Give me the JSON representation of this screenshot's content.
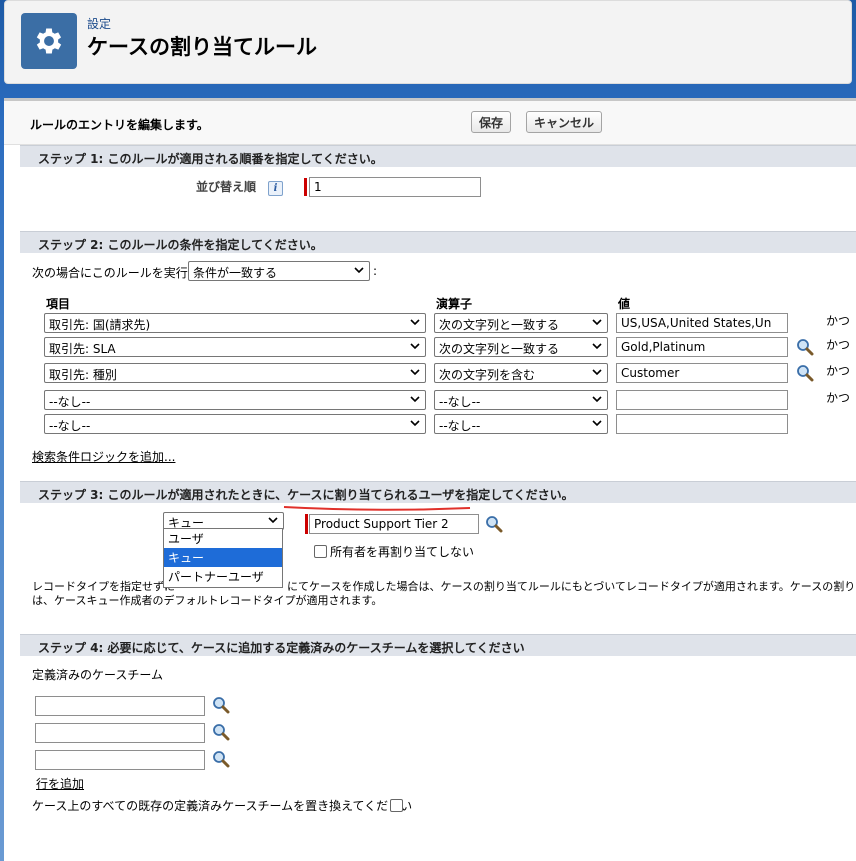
{
  "header": {
    "breadcrumb": "設定",
    "title": "ケースの割り当てルール",
    "icon": "gear-icon"
  },
  "topbar": {
    "title": "ルールのエントリを編集します。",
    "save_label": "保存",
    "cancel_label": "キャンセル"
  },
  "step1": {
    "title": "ステップ 1: このルールが適用される順番を指定してください。",
    "sort_label": "並び替え順",
    "sort_value": "1"
  },
  "step2": {
    "title": "ステップ 2: このルールの条件を指定してください。",
    "run_label": "次の場合にこのルールを実行:",
    "run_value": "条件が一致する",
    "run_suffix": ":",
    "col_field": "項目",
    "col_operator": "演算子",
    "col_value": "値",
    "rows": [
      {
        "field": "取引先: 国(請求先)",
        "operator": "次の文字列と一致する",
        "value": "US,USA,United States,Un",
        "and": "かつ"
      },
      {
        "field": "取引先: SLA",
        "operator": "次の文字列と一致する",
        "value": "Gold,Platinum",
        "and": "かつ"
      },
      {
        "field": "取引先: 種別",
        "operator": "次の文字列を含む",
        "value": "Customer",
        "and": "かつ"
      },
      {
        "field": "--なし--",
        "operator": "--なし--",
        "value": "",
        "and": "かつ"
      },
      {
        "field": "--なし--",
        "operator": "--なし--",
        "value": "",
        "and": ""
      }
    ],
    "add_logic_link": "検索条件ロジックを追加..."
  },
  "step3": {
    "title": "ステップ 3: このルールが適用されたときに、ケースに割り当てられるユーザを指定してください。",
    "assignee_type": "キュー",
    "assignee_options": [
      "ユーザ",
      "キュー",
      "パートナーユーザ"
    ],
    "assignee_selected_index": 1,
    "assignee_value": "Product Support Tier 2",
    "no_reassign_label": "所有者を再割り当てしない",
    "note_line1_left": "レコードタイプを指定せずに",
    "note_line1_right": "にてケースを作成した場合は、ケースの割り当てルールにもとづいてレコードタイプが適用されます。ケースの割り当て",
    "note_line2": "は、ケースキュー作成者のデフォルトレコードタイプが適用されます。"
  },
  "step4": {
    "title": "ステップ 4: 必要に応じて、ケースに追加する定義済みのケースチームを選択してください",
    "team_label": "定義済みのケースチーム",
    "team_values": [
      "",
      "",
      ""
    ],
    "add_row_link": "行を追加",
    "replace_label": "ケース上のすべての既存の定義済みケースチームを置き換えてください"
  },
  "colors": {
    "step_bar": "#dfe3ea",
    "required": "#cc0000",
    "selected_option": "#1e6cd8",
    "annotation_red": "#e0312b"
  }
}
